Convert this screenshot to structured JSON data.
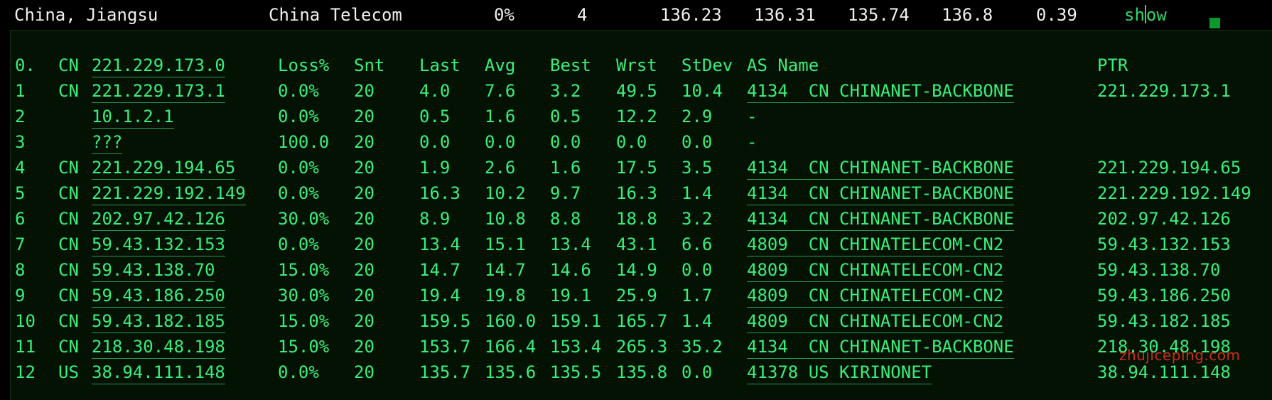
{
  "header": {
    "location": "China, Jiangsu",
    "isp": "China Telecom",
    "loss": "0%",
    "count": "4",
    "v1": "136.23",
    "v2": "136.31",
    "v3": "135.74",
    "v4": "136.8",
    "v5": "0.39",
    "show_prefix": "sh",
    "show_suffix": "ow"
  },
  "table": {
    "columns": {
      "idx": "0.",
      "cc": "CN",
      "host": "221.229.173.0",
      "loss": "Loss%",
      "snt": "Snt",
      "last": "Last",
      "avg": "Avg",
      "best": "Best",
      "wrst": "Wrst",
      "stdev": "StDev",
      "as": "AS Name",
      "ptr": "PTR"
    },
    "rows": [
      {
        "idx": "1",
        "cc": "CN",
        "host": "221.229.173.1",
        "loss": "0.0%",
        "snt": "20",
        "last": "4.0",
        "avg": "7.6",
        "best": "3.2",
        "wrst": "49.5",
        "stdev": "10.4",
        "as": "4134  CN CHINANET-BACKBONE",
        "ptr": "221.229.173.1"
      },
      {
        "idx": "2",
        "cc": "",
        "host": "10.1.2.1",
        "loss": "0.0%",
        "snt": "20",
        "last": "0.5",
        "avg": "1.6",
        "best": "0.5",
        "wrst": "12.2",
        "stdev": "2.9",
        "as": "-",
        "ptr": ""
      },
      {
        "idx": "3",
        "cc": "",
        "host": "???",
        "loss": "100.0",
        "snt": "20",
        "last": "0.0",
        "avg": "0.0",
        "best": "0.0",
        "wrst": "0.0",
        "stdev": "0.0",
        "as": "-",
        "ptr": ""
      },
      {
        "idx": "4",
        "cc": "CN",
        "host": "221.229.194.65",
        "loss": "0.0%",
        "snt": "20",
        "last": "1.9",
        "avg": "2.6",
        "best": "1.6",
        "wrst": "17.5",
        "stdev": "3.5",
        "as": "4134  CN CHINANET-BACKBONE",
        "ptr": "221.229.194.65"
      },
      {
        "idx": "5",
        "cc": "CN",
        "host": "221.229.192.149",
        "loss": "0.0%",
        "snt": "20",
        "last": "16.3",
        "avg": "10.2",
        "best": "9.7",
        "wrst": "16.3",
        "stdev": "1.4",
        "as": "4134  CN CHINANET-BACKBONE",
        "ptr": "221.229.192.149"
      },
      {
        "idx": "6",
        "cc": "CN",
        "host": "202.97.42.126",
        "loss": "30.0%",
        "snt": "20",
        "last": "8.9",
        "avg": "10.8",
        "best": "8.8",
        "wrst": "18.8",
        "stdev": "3.2",
        "as": "4134  CN CHINANET-BACKBONE",
        "ptr": "202.97.42.126"
      },
      {
        "idx": "7",
        "cc": "CN",
        "host": "59.43.132.153",
        "loss": "0.0%",
        "snt": "20",
        "last": "13.4",
        "avg": "15.1",
        "best": "13.4",
        "wrst": "43.1",
        "stdev": "6.6",
        "as": "4809  CN CHINATELECOM-CN2",
        "ptr": "59.43.132.153"
      },
      {
        "idx": "8",
        "cc": "CN",
        "host": "59.43.138.70",
        "loss": "15.0%",
        "snt": "20",
        "last": "14.7",
        "avg": "14.7",
        "best": "14.6",
        "wrst": "14.9",
        "stdev": "0.0",
        "as": "4809  CN CHINATELECOM-CN2",
        "ptr": "59.43.138.70"
      },
      {
        "idx": "9",
        "cc": "CN",
        "host": "59.43.186.250",
        "loss": "30.0%",
        "snt": "20",
        "last": "19.4",
        "avg": "19.8",
        "best": "19.1",
        "wrst": "25.9",
        "stdev": "1.7",
        "as": "4809  CN CHINATELECOM-CN2",
        "ptr": "59.43.186.250"
      },
      {
        "idx": "10",
        "cc": "CN",
        "host": "59.43.182.185",
        "loss": "15.0%",
        "snt": "20",
        "last": "159.5",
        "avg": "160.0",
        "best": "159.1",
        "wrst": "165.7",
        "stdev": "1.4",
        "as": "4809  CN CHINATELECOM-CN2",
        "ptr": "59.43.182.185"
      },
      {
        "idx": "11",
        "cc": "CN",
        "host": "218.30.48.198",
        "loss": "15.0%",
        "snt": "20",
        "last": "153.7",
        "avg": "166.4",
        "best": "153.4",
        "wrst": "265.3",
        "stdev": "35.2",
        "as": "4134  CN CHINANET-BACKBONE",
        "ptr": "218.30.48.198"
      },
      {
        "idx": "12",
        "cc": "US",
        "host": "38.94.111.148",
        "loss": "0.0%",
        "snt": "20",
        "last": "135.7",
        "avg": "135.6",
        "best": "135.5",
        "wrst": "135.8",
        "stdev": "0.0",
        "as": "41378 US KIRINONET",
        "ptr": "38.94.111.148"
      }
    ]
  },
  "watermark": "zhujiceping.com",
  "colors": {
    "background": "#000000",
    "panel": "#031203",
    "text_green": "#39ef7a",
    "header_text": "#f0f0f0",
    "watermark": "#e0301e"
  }
}
